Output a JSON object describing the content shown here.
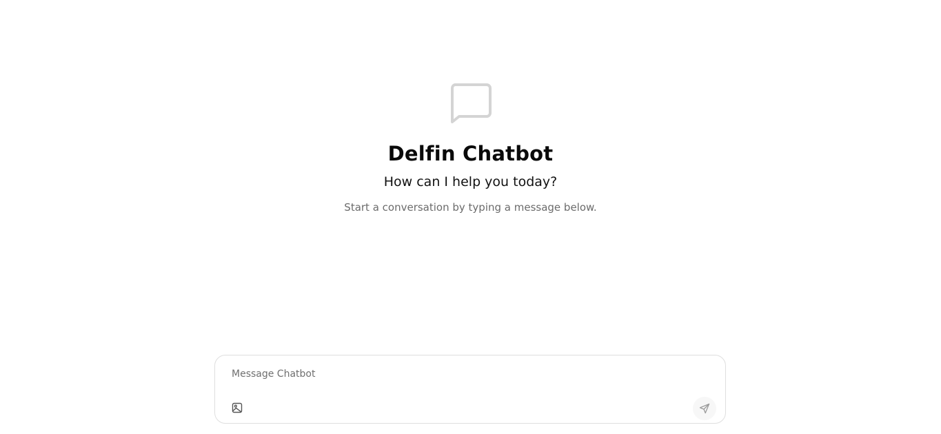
{
  "app": {
    "title": "Delfin Chatbot",
    "subtitle": "How can I help you today?",
    "hint": "Start a conversation by typing a message below."
  },
  "composer": {
    "placeholder": "Message Chatbot",
    "value": "",
    "attach_icon": "image-icon",
    "send_icon": "send-icon"
  },
  "hero": {
    "icon": "message-square-icon"
  },
  "colors": {
    "icon_gray": "#d4d4d4",
    "hint_text": "#6b6b6b",
    "border": "#dedede"
  }
}
